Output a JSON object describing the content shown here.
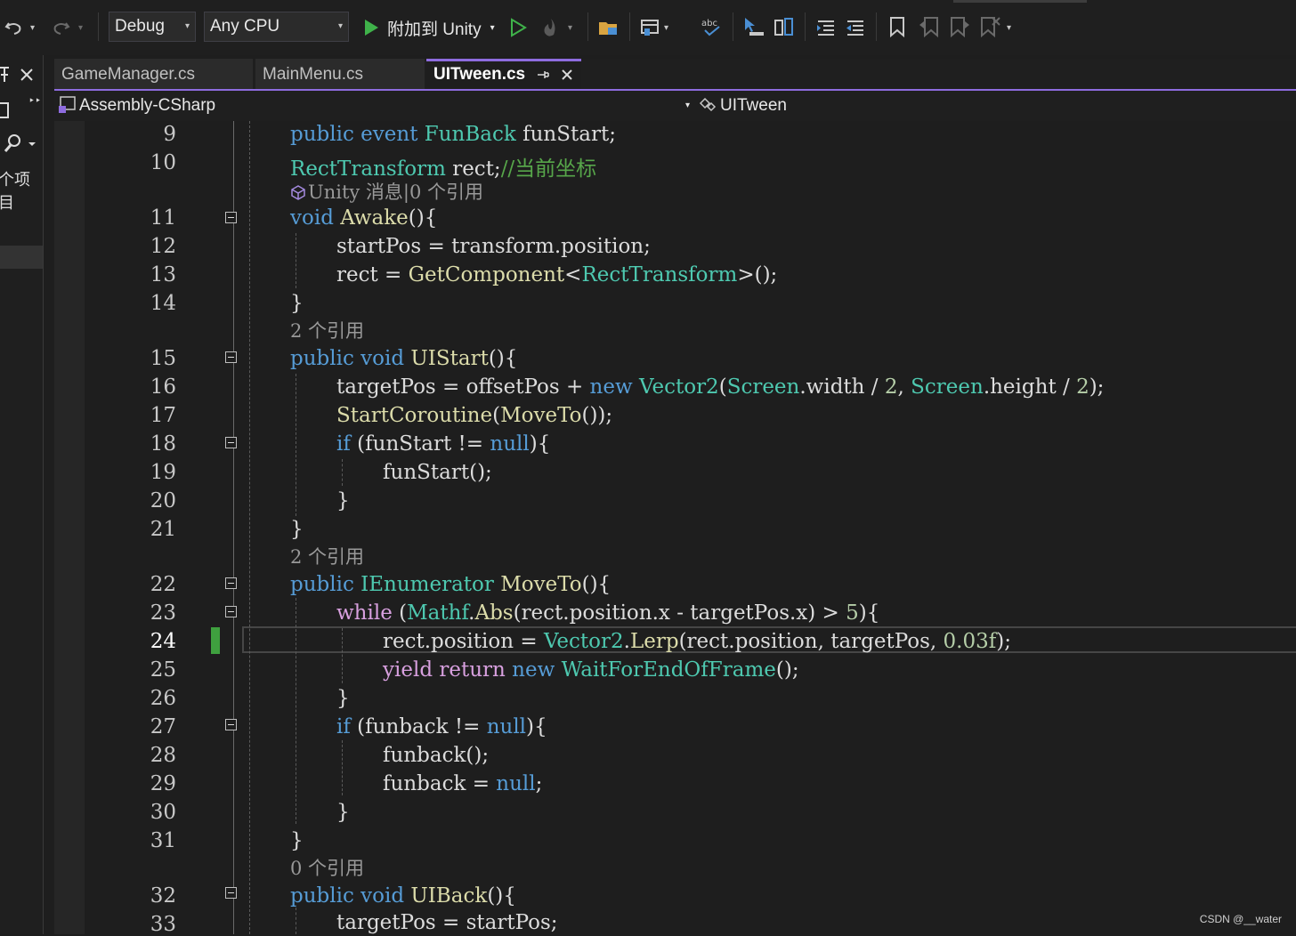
{
  "toolbar": {
    "config": "Debug",
    "platform": "Any CPU",
    "attach_label": "附加到 Unity",
    "arrow": "▾"
  },
  "left_panel": {
    "project_label": "个项目"
  },
  "tabs": [
    {
      "label": "GameManager.cs"
    },
    {
      "label": "MainMenu.cs"
    },
    {
      "label": "UITween.cs"
    }
  ],
  "nav": {
    "project": "Assembly-CSharp",
    "class": "UITween"
  },
  "editor": {
    "current_line": "24",
    "line_numbers": [
      "9",
      "10",
      "11",
      "12",
      "13",
      "14",
      "15",
      "16",
      "17",
      "18",
      "19",
      "20",
      "21",
      "22",
      "23",
      "24",
      "25",
      "26",
      "27",
      "28",
      "29",
      "30",
      "31",
      "32",
      "33"
    ],
    "codelens": [
      "Unity 消息|0 个引用",
      "2 个引用",
      "2 个引用",
      "0 个引用"
    ],
    "code": {
      "l9": [
        "public",
        "event",
        "FunBack",
        "funStart;"
      ],
      "l10": [
        "RectTransform",
        "rect;",
        "//当前坐标"
      ],
      "l11": [
        "void",
        "Awake",
        "(){"
      ],
      "l12": [
        "startPos = transform.position;"
      ],
      "l13": [
        "rect = ",
        "GetComponent",
        "<",
        "RectTransform",
        ">();"
      ],
      "l14": [
        "}"
      ],
      "l15": [
        "public",
        "void",
        "UIStart",
        "(){"
      ],
      "l16": [
        "targetPos = offsetPos + ",
        "new",
        "Vector2",
        "(",
        "Screen",
        ".width / ",
        "2",
        ", ",
        "Screen",
        ".height / ",
        "2",
        ");"
      ],
      "l17": [
        "StartCoroutine",
        "(",
        "MoveTo",
        "());"
      ],
      "l18": [
        "if",
        " (funStart != ",
        "null",
        "){"
      ],
      "l19": [
        "funStart",
        "();"
      ],
      "l20": [
        "}"
      ],
      "l21": [
        "}"
      ],
      "l22": [
        "public",
        "IEnumerator",
        "MoveTo",
        "(){"
      ],
      "l23": [
        "while",
        " (",
        "Mathf",
        ".",
        "Abs",
        "(rect.position.x - targetPos.x) > ",
        "5",
        "){"
      ],
      "l24": [
        "rect.position = ",
        "Vector2",
        ".",
        "Lerp",
        "(rect.position, targetPos, ",
        "0.03f",
        ");"
      ],
      "l25": [
        "yield",
        "return",
        "new",
        "WaitForEndOfFrame",
        "();"
      ],
      "l26": [
        "}"
      ],
      "l27": [
        "if",
        " (funback != ",
        "null",
        "){"
      ],
      "l28": [
        "funback",
        "();"
      ],
      "l29": [
        "funback = ",
        "null",
        ";"
      ],
      "l30": [
        "}"
      ],
      "l31": [
        "}"
      ],
      "l32": [
        "public",
        "void",
        "UIBack",
        "(){"
      ],
      "l33": [
        "targetPos = startPos;"
      ]
    }
  },
  "watermark": "CSDN @__water",
  "colors": {
    "background": "#1e1e1e",
    "keyword": "#569cd6",
    "type": "#4ec9b0",
    "method": "#dcdcaa",
    "comment": "#57a64a",
    "number": "#b5cea8",
    "accent": "#8e6cdf",
    "change_marker": "#3fa03f"
  }
}
